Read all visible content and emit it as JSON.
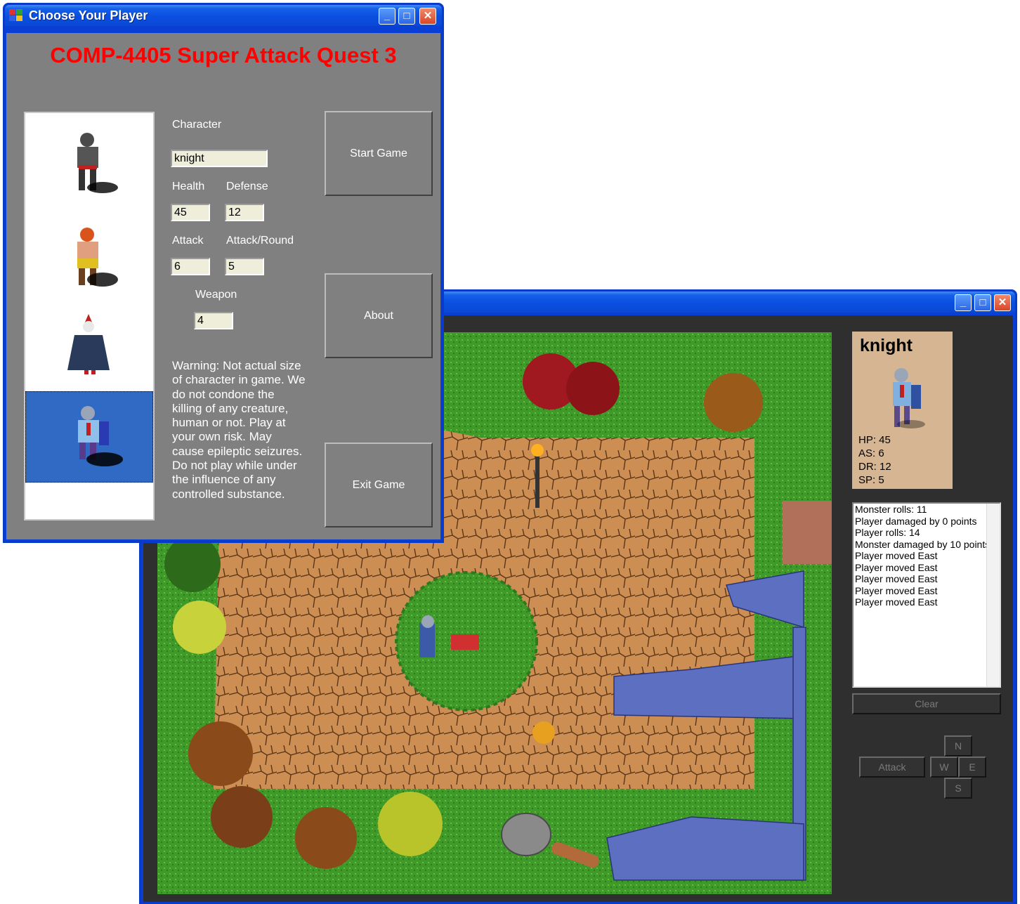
{
  "chooser": {
    "title": "Choose Your Player",
    "heading": "COMP-4405 Super Attack Quest 3",
    "roster": [
      "warrior-sprite",
      "dwarf-sprite",
      "wizard-sprite",
      "knight-sprite"
    ],
    "selected_index": 3,
    "labels": {
      "character": "Character",
      "health": "Health",
      "defense": "Defense",
      "attack": "Attack",
      "attack_round": "Attack/Round",
      "weapon": "Weapon"
    },
    "values": {
      "character": "knight",
      "health": "45",
      "defense": "12",
      "attack": "6",
      "attack_round": "5",
      "weapon": "4"
    },
    "warning": "Warning: Not actual size of character in game.  We do not condone the killing of any creature, human or not.  Play at your own risk.  May cause epileptic seizures.  Do not play while under the influence of any controlled substance.",
    "buttons": {
      "start": "Start Game",
      "about": "About",
      "exit": "Exit Game"
    }
  },
  "game": {
    "title": "",
    "player_card": {
      "name": "knight",
      "hp": "HP: 45",
      "as": "AS: 6",
      "dr": "DR: 12",
      "sp": "SP: 5"
    },
    "log": [
      "Monster rolls: 11",
      "Player damaged by 0 points",
      "Player rolls: 14",
      "Monster damaged by 10 points",
      "Player moved East",
      "Player moved East",
      "Player moved East",
      "Player moved East",
      "Player moved East"
    ],
    "buttons": {
      "clear": "Clear",
      "attack": "Attack",
      "north": "N",
      "west": "W",
      "east": "E",
      "south": "S"
    }
  },
  "colors": {
    "titlebar": "#0b4fe0",
    "heading": "#ff0000",
    "form_bg": "#808080",
    "selection": "#316ac5",
    "card_bg": "#d6b692",
    "grass": "#3f9a2a",
    "path": "#c8884a"
  }
}
